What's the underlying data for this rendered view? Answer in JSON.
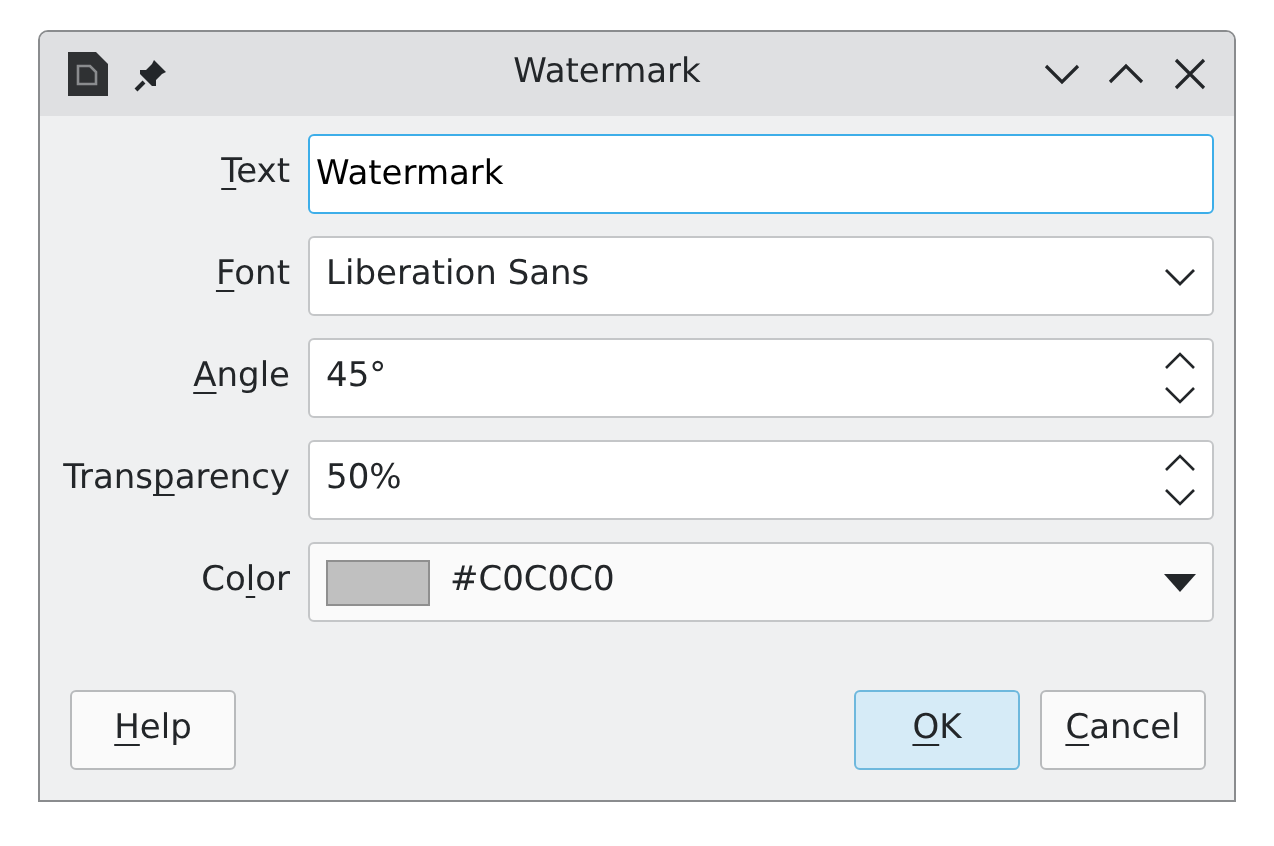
{
  "window": {
    "title": "Watermark"
  },
  "fields": [
    {
      "kind": "text",
      "label": {
        "key": "T",
        "after": "ext"
      },
      "value": "Watermark",
      "focused": true
    },
    {
      "kind": "dropdown",
      "label": {
        "key": "F",
        "after": "ont"
      },
      "value": "Liberation Sans",
      "focused": false
    },
    {
      "kind": "spin",
      "label": {
        "key": "A",
        "after": "ngle"
      },
      "value": "45°",
      "focused": false
    },
    {
      "kind": "spin",
      "label": {
        "before": "Trans",
        "key": "p",
        "after": "arency"
      },
      "value": "50%",
      "focused": false
    },
    {
      "kind": "color",
      "label": {
        "before": "Co",
        "key": "l",
        "after": "or"
      },
      "value": "#C0C0C0",
      "color": "#c0c0c0",
      "focused": false
    }
  ],
  "buttons": [
    {
      "kind": "help",
      "label": {
        "key": "H",
        "after": "elp"
      },
      "default": false
    },
    {
      "kind": "action",
      "label": {
        "key": "O",
        "after": "K"
      },
      "default": true
    },
    {
      "kind": "action",
      "label": {
        "key": "C",
        "after": "ancel"
      },
      "default": false
    }
  ]
}
